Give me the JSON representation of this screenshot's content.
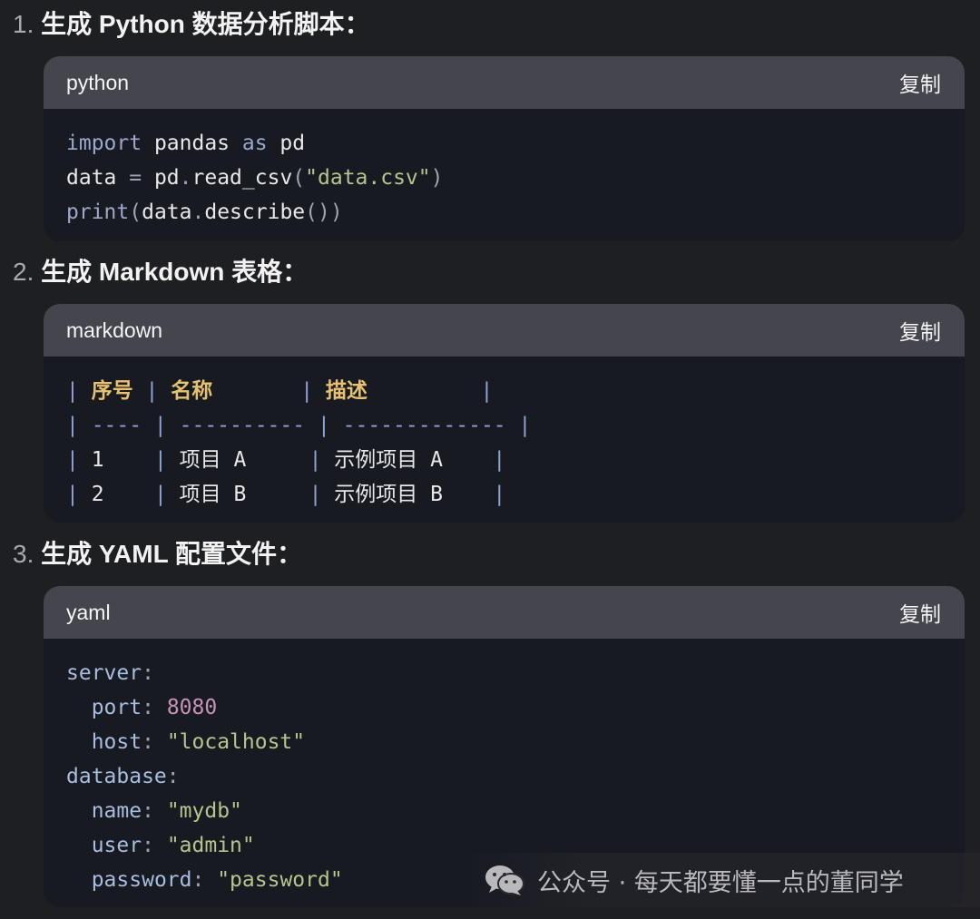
{
  "sections": [
    {
      "number": "1.",
      "title": "生成 Python 数据分析脚本：",
      "code": {
        "language": "python",
        "copy_label": "复制",
        "lines": [
          [
            [
              "kw",
              "import"
            ],
            [
              "t",
              " pandas "
            ],
            [
              "kw",
              "as"
            ],
            [
              "t",
              " pd"
            ]
          ],
          [
            [
              "t",
              "data "
            ],
            [
              "pun",
              "="
            ],
            [
              "t",
              " pd"
            ],
            [
              "pun",
              "."
            ],
            [
              "t",
              "read_csv"
            ],
            [
              "pun",
              "("
            ],
            [
              "str",
              "\"data.csv\""
            ],
            [
              "pun",
              ")"
            ]
          ],
          [
            [
              "kw",
              "print"
            ],
            [
              "pun",
              "("
            ],
            [
              "t",
              "data"
            ],
            [
              "pun",
              "."
            ],
            [
              "t",
              "describe"
            ],
            [
              "pun",
              "())"
            ]
          ]
        ]
      }
    },
    {
      "number": "2.",
      "title": "生成 Markdown 表格：",
      "code": {
        "language": "markdown",
        "copy_label": "复制",
        "lines": [
          [
            [
              "pipe",
              "| "
            ],
            [
              "hdr",
              "序号"
            ],
            [
              "pipe",
              " | "
            ],
            [
              "hdr",
              "名称"
            ],
            [
              "t",
              "       "
            ],
            [
              "pipe",
              "| "
            ],
            [
              "hdr",
              "描述"
            ],
            [
              "t",
              "         "
            ],
            [
              "pipe",
              "|"
            ]
          ],
          [
            [
              "pipe",
              "| ---- | ---------- | ------------- |"
            ]
          ],
          [
            [
              "pipe",
              "| "
            ],
            [
              "t",
              "1    "
            ],
            [
              "pipe",
              "| "
            ],
            [
              "t",
              "项目 A     "
            ],
            [
              "pipe",
              "| "
            ],
            [
              "t",
              "示例项目 A    "
            ],
            [
              "pipe",
              "|"
            ]
          ],
          [
            [
              "pipe",
              "| "
            ],
            [
              "t",
              "2    "
            ],
            [
              "pipe",
              "| "
            ],
            [
              "t",
              "项目 B     "
            ],
            [
              "pipe",
              "| "
            ],
            [
              "t",
              "示例项目 B    "
            ],
            [
              "pipe",
              "|"
            ]
          ]
        ]
      }
    },
    {
      "number": "3.",
      "title": "生成 YAML 配置文件：",
      "code": {
        "language": "yaml",
        "copy_label": "复制",
        "lines": [
          [
            [
              "key",
              "server"
            ],
            [
              "pun",
              ":"
            ]
          ],
          [
            [
              "t",
              "  "
            ],
            [
              "key",
              "port"
            ],
            [
              "pun",
              ":"
            ],
            [
              "t",
              " "
            ],
            [
              "num",
              "8080"
            ]
          ],
          [
            [
              "t",
              "  "
            ],
            [
              "key",
              "host"
            ],
            [
              "pun",
              ":"
            ],
            [
              "t",
              " "
            ],
            [
              "str",
              "\"localhost\""
            ]
          ],
          [
            [
              "key",
              "database"
            ],
            [
              "pun",
              ":"
            ]
          ],
          [
            [
              "t",
              "  "
            ],
            [
              "key",
              "name"
            ],
            [
              "pun",
              ":"
            ],
            [
              "t",
              " "
            ],
            [
              "str",
              "\"mydb\""
            ]
          ],
          [
            [
              "t",
              "  "
            ],
            [
              "key",
              "user"
            ],
            [
              "pun",
              ":"
            ],
            [
              "t",
              " "
            ],
            [
              "str",
              "\"admin\""
            ]
          ],
          [
            [
              "t",
              "  "
            ],
            [
              "key",
              "password"
            ],
            [
              "pun",
              ":"
            ],
            [
              "t",
              " "
            ],
            [
              "str",
              "\"password\""
            ]
          ]
        ]
      }
    }
  ],
  "watermark": {
    "icon": "wechat-icon",
    "text": "公众号 · 每天都要懂一点的董同学"
  },
  "colors": {
    "background": "#1e1f22",
    "code_background": "#181a22",
    "code_header": "#44454d",
    "keyword": "#9ca7cc",
    "string": "#b7c48c",
    "number": "#c792b6",
    "yaml_key": "#a7bde0",
    "table_header": "#e8c170"
  }
}
